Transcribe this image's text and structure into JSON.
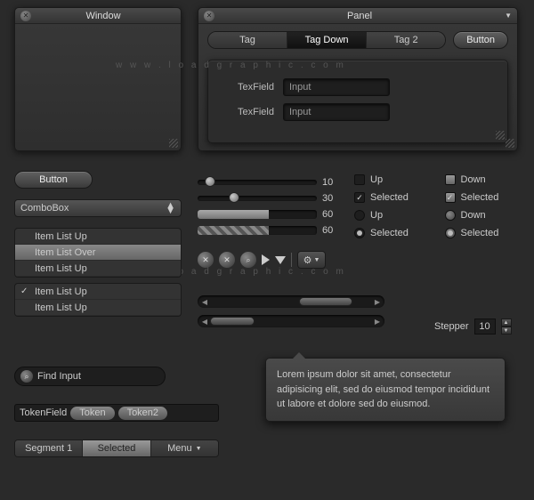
{
  "watermark": "w w w . l o a d g r a p h i c . c o m",
  "window": {
    "title": "Window"
  },
  "panel": {
    "title": "Panel",
    "tabs": [
      "Tag",
      "Tag Down",
      "Tag 2"
    ],
    "button": "Button",
    "field_label": "TexField",
    "field_value": "Input"
  },
  "left": {
    "button": "Button",
    "combo": "ComboBox",
    "list1": [
      "Item List Up",
      "Item List Over",
      "Item List Up"
    ],
    "list2": [
      "Item List Up",
      "Item List Up"
    ],
    "find": "Find Input",
    "tokenfield_label": "TokenField",
    "tokens": [
      "Token",
      "Token2"
    ],
    "segments": [
      "Segment 1",
      "Selected",
      "Menu"
    ]
  },
  "sliders": {
    "v1": "10",
    "v2": "30",
    "p1": "60",
    "p2": "60"
  },
  "controls": {
    "up": "Up",
    "down": "Down",
    "selected": "Selected"
  },
  "stepper": {
    "label": "Stepper",
    "value": "10"
  },
  "tooltip": "Lorem ipsum dolor sit amet, consectetur adipisicing elit, sed do eiusmod tempor incididunt ut labore et dolore sed do eiusmod."
}
